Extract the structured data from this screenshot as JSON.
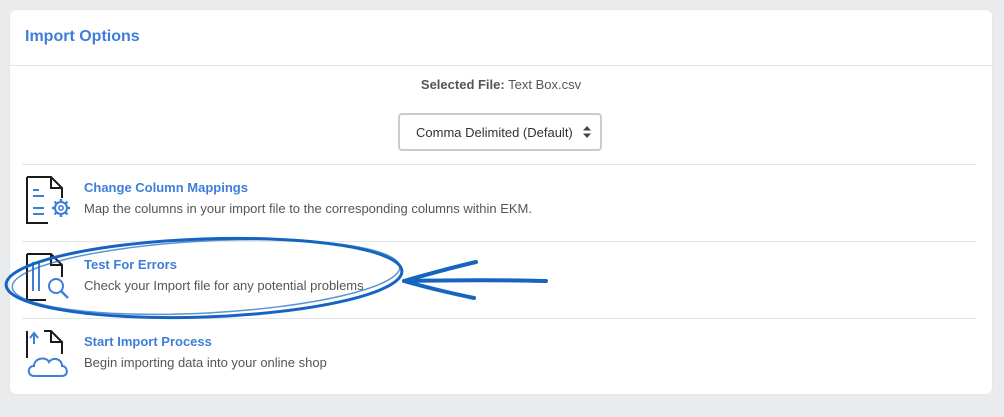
{
  "panel": {
    "title": "Import Options"
  },
  "file": {
    "label": "Selected File:",
    "name": "Text Box.csv"
  },
  "delimiter_select": {
    "selected": "Comma Delimited (Default)"
  },
  "options": [
    {
      "title": "Change Column Mappings",
      "description": "Map the columns in your import file to the corresponding columns within EKM.",
      "icon": "document-settings-icon"
    },
    {
      "title": "Test For Errors",
      "description": "Check your Import file for any potential problems",
      "icon": "document-search-icon"
    },
    {
      "title": "Start Import Process",
      "description": "Begin importing data into your online shop",
      "icon": "cloud-upload-icon"
    }
  ],
  "colors": {
    "accent": "#3f7ed8",
    "annotation": "#1565c0",
    "background": "#e9ebec"
  }
}
